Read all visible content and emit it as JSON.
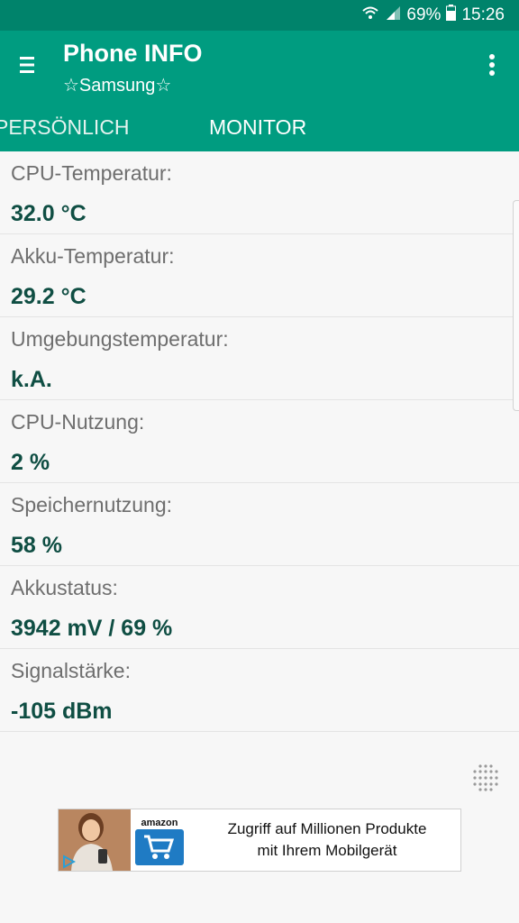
{
  "status_bar": {
    "battery": "69%",
    "time": "15:26"
  },
  "app_bar": {
    "title": "Phone INFO",
    "subtitle": "☆Samsung☆"
  },
  "tabs": [
    {
      "label": "PERSÖNLICH",
      "active": false
    },
    {
      "label": "MONITOR",
      "active": true
    }
  ],
  "rows": [
    {
      "label": "CPU-Temperatur:",
      "value": "32.0 °C"
    },
    {
      "label": "Akku-Temperatur:",
      "value": "29.2 °C"
    },
    {
      "label": "Umgebungstemperatur:",
      "value": "k.A."
    },
    {
      "label": "CPU-Nutzung:",
      "value": "2 %"
    },
    {
      "label": "Speichernutzung:",
      "value": "58 %"
    },
    {
      "label": "Akkustatus:",
      "value": "3942 mV / 69 %"
    },
    {
      "label": "Signalstärke:",
      "value": "-105 dBm"
    }
  ],
  "ad": {
    "brand": "amazon",
    "line1": "Zugriff auf Millionen Produkte",
    "line2": "mit Ihrem Mobilgerät"
  },
  "icons": {
    "menu": "menu-icon",
    "overflow": "more-vert-icon",
    "wifi": "wifi-icon",
    "signal": "cell-signal-icon",
    "battery": "battery-icon",
    "grid": "dots-grid-icon"
  },
  "colors": {
    "status_bar": "#00836b",
    "app_bar": "#009c80",
    "value_text": "#0f4e43",
    "label_text": "#6e6e6e",
    "background": "#f7f7f7"
  }
}
